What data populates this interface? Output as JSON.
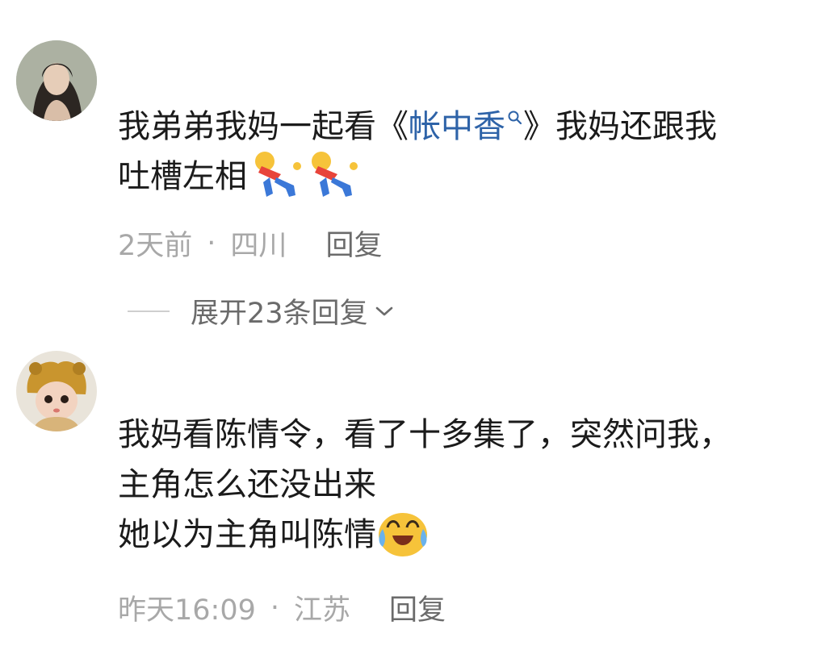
{
  "comments": [
    {
      "text_before_link": "我弟弟我妈一起看《",
      "link_text": "帐中香",
      "text_after_link": "》我妈还跟我",
      "line2": "吐槽左相",
      "meta": {
        "time": "2天前",
        "dot": "·",
        "location": "四川",
        "reply_label": "回复"
      },
      "avatar_icon": "girl-portrait-avatar",
      "emoji_icons": [
        "fallen-person-emoji",
        "fallen-person-emoji"
      ]
    },
    {
      "line1": "我妈看陈情令，看了十多集了，突然问我，",
      "line2": "主角怎么还没出来",
      "line3": "她以为主角叫陈情",
      "meta": {
        "time": "昨天16:09",
        "dot": "·",
        "location": "江苏",
        "reply_label": "回复"
      },
      "avatar_icon": "doll-with-hat-avatar",
      "emoji_icons": [
        "laugh-cry-emoji"
      ]
    }
  ],
  "expand_replies": {
    "label": "展开23条回复"
  },
  "colors": {
    "link": "#2e63a8",
    "meta": "#a8a8a8",
    "reply": "#6b6b6b",
    "text": "#1b1b1b"
  }
}
